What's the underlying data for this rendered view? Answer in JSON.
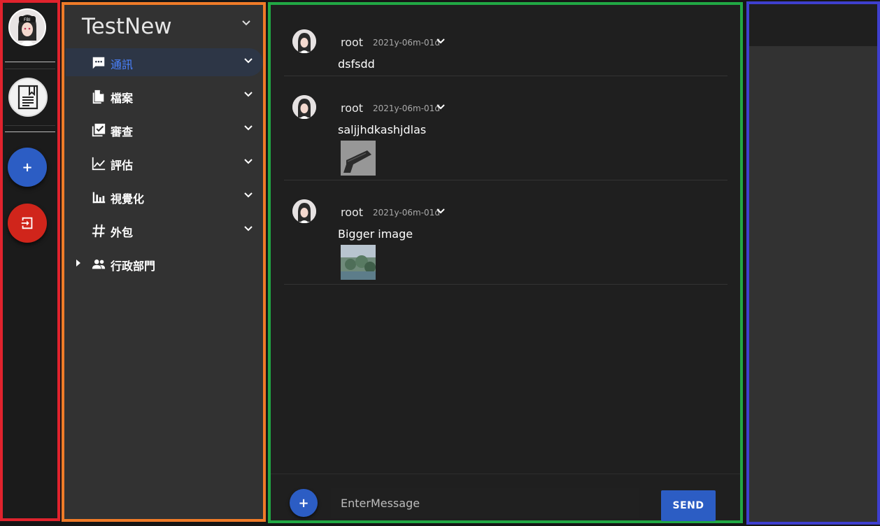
{
  "team": {
    "name": "TestNew"
  },
  "nav": {
    "items": [
      {
        "label": "通訊",
        "icon": "chat-icon",
        "active": true
      },
      {
        "label": "檔案",
        "icon": "file-icon"
      },
      {
        "label": "審查",
        "icon": "review-icon"
      },
      {
        "label": "評估",
        "icon": "chart-line-icon"
      },
      {
        "label": "視覺化",
        "icon": "bar-chart-icon"
      },
      {
        "label": "外包",
        "icon": "hash-icon"
      },
      {
        "label": "行政部門",
        "icon": "group-icon"
      }
    ]
  },
  "messages": [
    {
      "user": "root",
      "date": "2021y-06m-01d",
      "text": "dsfsdd"
    },
    {
      "user": "root",
      "date": "2021y-06m-01d",
      "text": "saljjhdkashjdlas",
      "image": "gun-thumbnail"
    },
    {
      "user": "root",
      "date": "2021y-06m-01d",
      "text": "Bigger image",
      "image": "landscape-thumbnail"
    }
  ],
  "composer": {
    "placeholder": "EnterMessage",
    "send_label": "SEND"
  },
  "colors": {
    "accent": "#2c5dc4",
    "danger": "#d0251b",
    "active_text": "#4a82ff"
  }
}
